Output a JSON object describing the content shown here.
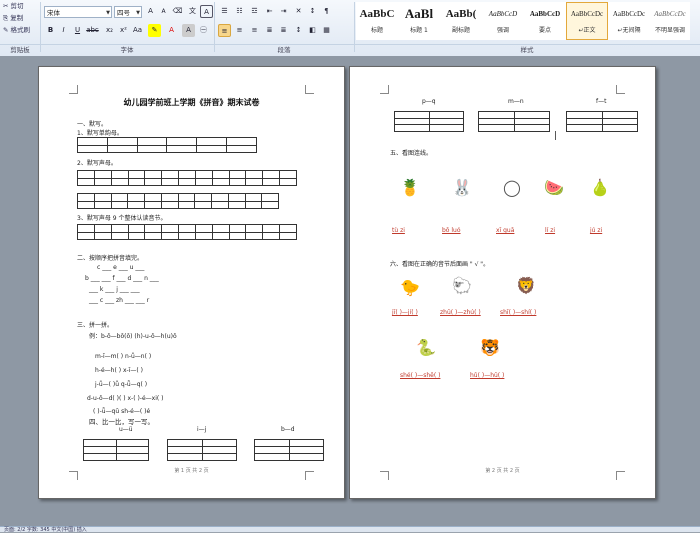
{
  "clipboard": {
    "cut": "剪切",
    "copy": "复制",
    "format_painter": "格式刷",
    "group": "剪贴板"
  },
  "font": {
    "name": "宋体",
    "size": "四号",
    "group": "字体"
  },
  "paragraph": {
    "group": "段落"
  },
  "styles": {
    "group": "样式",
    "items": [
      {
        "sample": "AaBbC",
        "name": "标题"
      },
      {
        "sample": "AaBl",
        "name": "标题 1"
      },
      {
        "sample": "AaBb(",
        "name": "副标题"
      },
      {
        "sample": "AaBbCcD",
        "name": "强调"
      },
      {
        "sample": "AaBbCcD",
        "name": "要点"
      },
      {
        "sample": "AaBbCcDc",
        "name": "↵正文"
      },
      {
        "sample": "AaBbCcDc",
        "name": "↵无间隔"
      },
      {
        "sample": "AaBbCcDc",
        "name": "不明显强调"
      },
      {
        "sample": "AaBbCcDc",
        "name": "明显强"
      }
    ]
  },
  "page1": {
    "title": "幼儿园学前班上学期《拼音》期末试卷",
    "s1": "一、默写。",
    "s1a": "1、默写单韵母。",
    "s1b": "2、默写声母。",
    "s1c": "3、默写声母 9 个整体认读音节。",
    "s2": "二、按顺序把拼音填完。",
    "s2_rows": [
      "c ___ e ___ u ___",
      "b ___ ___ f ___ d ___ n ___",
      "___ k ___ j ___ ___",
      "___ c ___ zh ___ ___ r"
    ],
    "s3": "三、拼一拼。",
    "s3_example": "例：b-ō—bō(ō)          (h)-u-ō—h(u)ō",
    "s3_rows": [
      "m-ī—m(   )           n-ǚ—n(   )",
      "h-é—h(   )            x-ī—(   )",
      "j-ǚ—(   )ǚ             q-ǖ—q(   )",
      "d-u-ō—d(   )(   )       x-(   )-é—xi(   )",
      "(   )-ǖ—qū              sh-é—(   )é"
    ],
    "s4": "四、比一比，写一写。",
    "s4_labels": [
      "u—ü",
      "i—j",
      "b—d"
    ],
    "footer": "第 1 页 共 2 页"
  },
  "page2": {
    "top_labels": [
      "p—q",
      "m—n",
      "f—t"
    ],
    "s5": "五、看图连线。",
    "s5_pics": [
      "pineapple-icon",
      "rabbit-icon",
      "orange-icon",
      "watermelon-icon",
      "pear-icon"
    ],
    "s5_words": [
      "tù zi",
      "bō luó",
      "xī guā",
      "lí zi",
      "jú zi"
    ],
    "s6": "六、看图在正确的音节后面画 \" √ \"。",
    "s6_pics_top": [
      "chick-icon",
      "sheep-icon",
      "lion-icon"
    ],
    "s6_words_top": [
      "jī(   )—jí(   )",
      "zhū(   )—zhú(   )",
      "shī(   )—shí(   )"
    ],
    "s6_pics_bottom": [
      "snake-icon",
      "tiger-icon"
    ],
    "s6_words_bottom": [
      "shé(   )—shē(   )",
      "hǔ(   )—hū(   )"
    ],
    "footer": "第 2 页 共 2 页"
  },
  "statusbar": {
    "text": "页面: 2/2   字数: 345   中文(中国)   插入"
  }
}
